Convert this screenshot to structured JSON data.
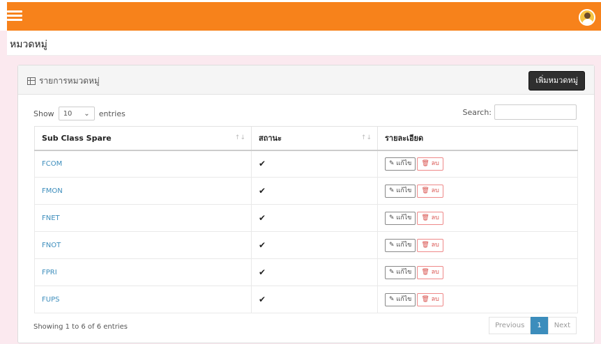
{
  "header": {
    "menu_icon": "hamburger-icon",
    "avatar_icon": "user-avatar-icon",
    "bar_color": "#f7821b"
  },
  "page": {
    "title": "หมวดหมู่"
  },
  "card": {
    "title": "รายการหมวดหมู่",
    "title_icon": "table-icon",
    "add_button": "เพิ่มหมวดหมู่"
  },
  "controls": {
    "show_label": "Show",
    "page_size": "10",
    "entries_label": "entries",
    "search_label": "Search:",
    "search_value": ""
  },
  "table": {
    "columns": [
      "Sub Class Spare",
      "สถานะ",
      "รายละเอียด"
    ],
    "rows": [
      {
        "name": "FCOM",
        "status": "✔"
      },
      {
        "name": "FMON",
        "status": "✔"
      },
      {
        "name": "FNET",
        "status": "✔"
      },
      {
        "name": "FNOT",
        "status": "✔"
      },
      {
        "name": "FPRI",
        "status": "✔"
      },
      {
        "name": "FUPS",
        "status": "✔"
      }
    ],
    "edit_label": "แก้ไข",
    "delete_label": "ลบ"
  },
  "footer": {
    "info": "Showing 1 to 6 of 6 entries",
    "previous": "Previous",
    "page": "1",
    "next": "Next"
  }
}
